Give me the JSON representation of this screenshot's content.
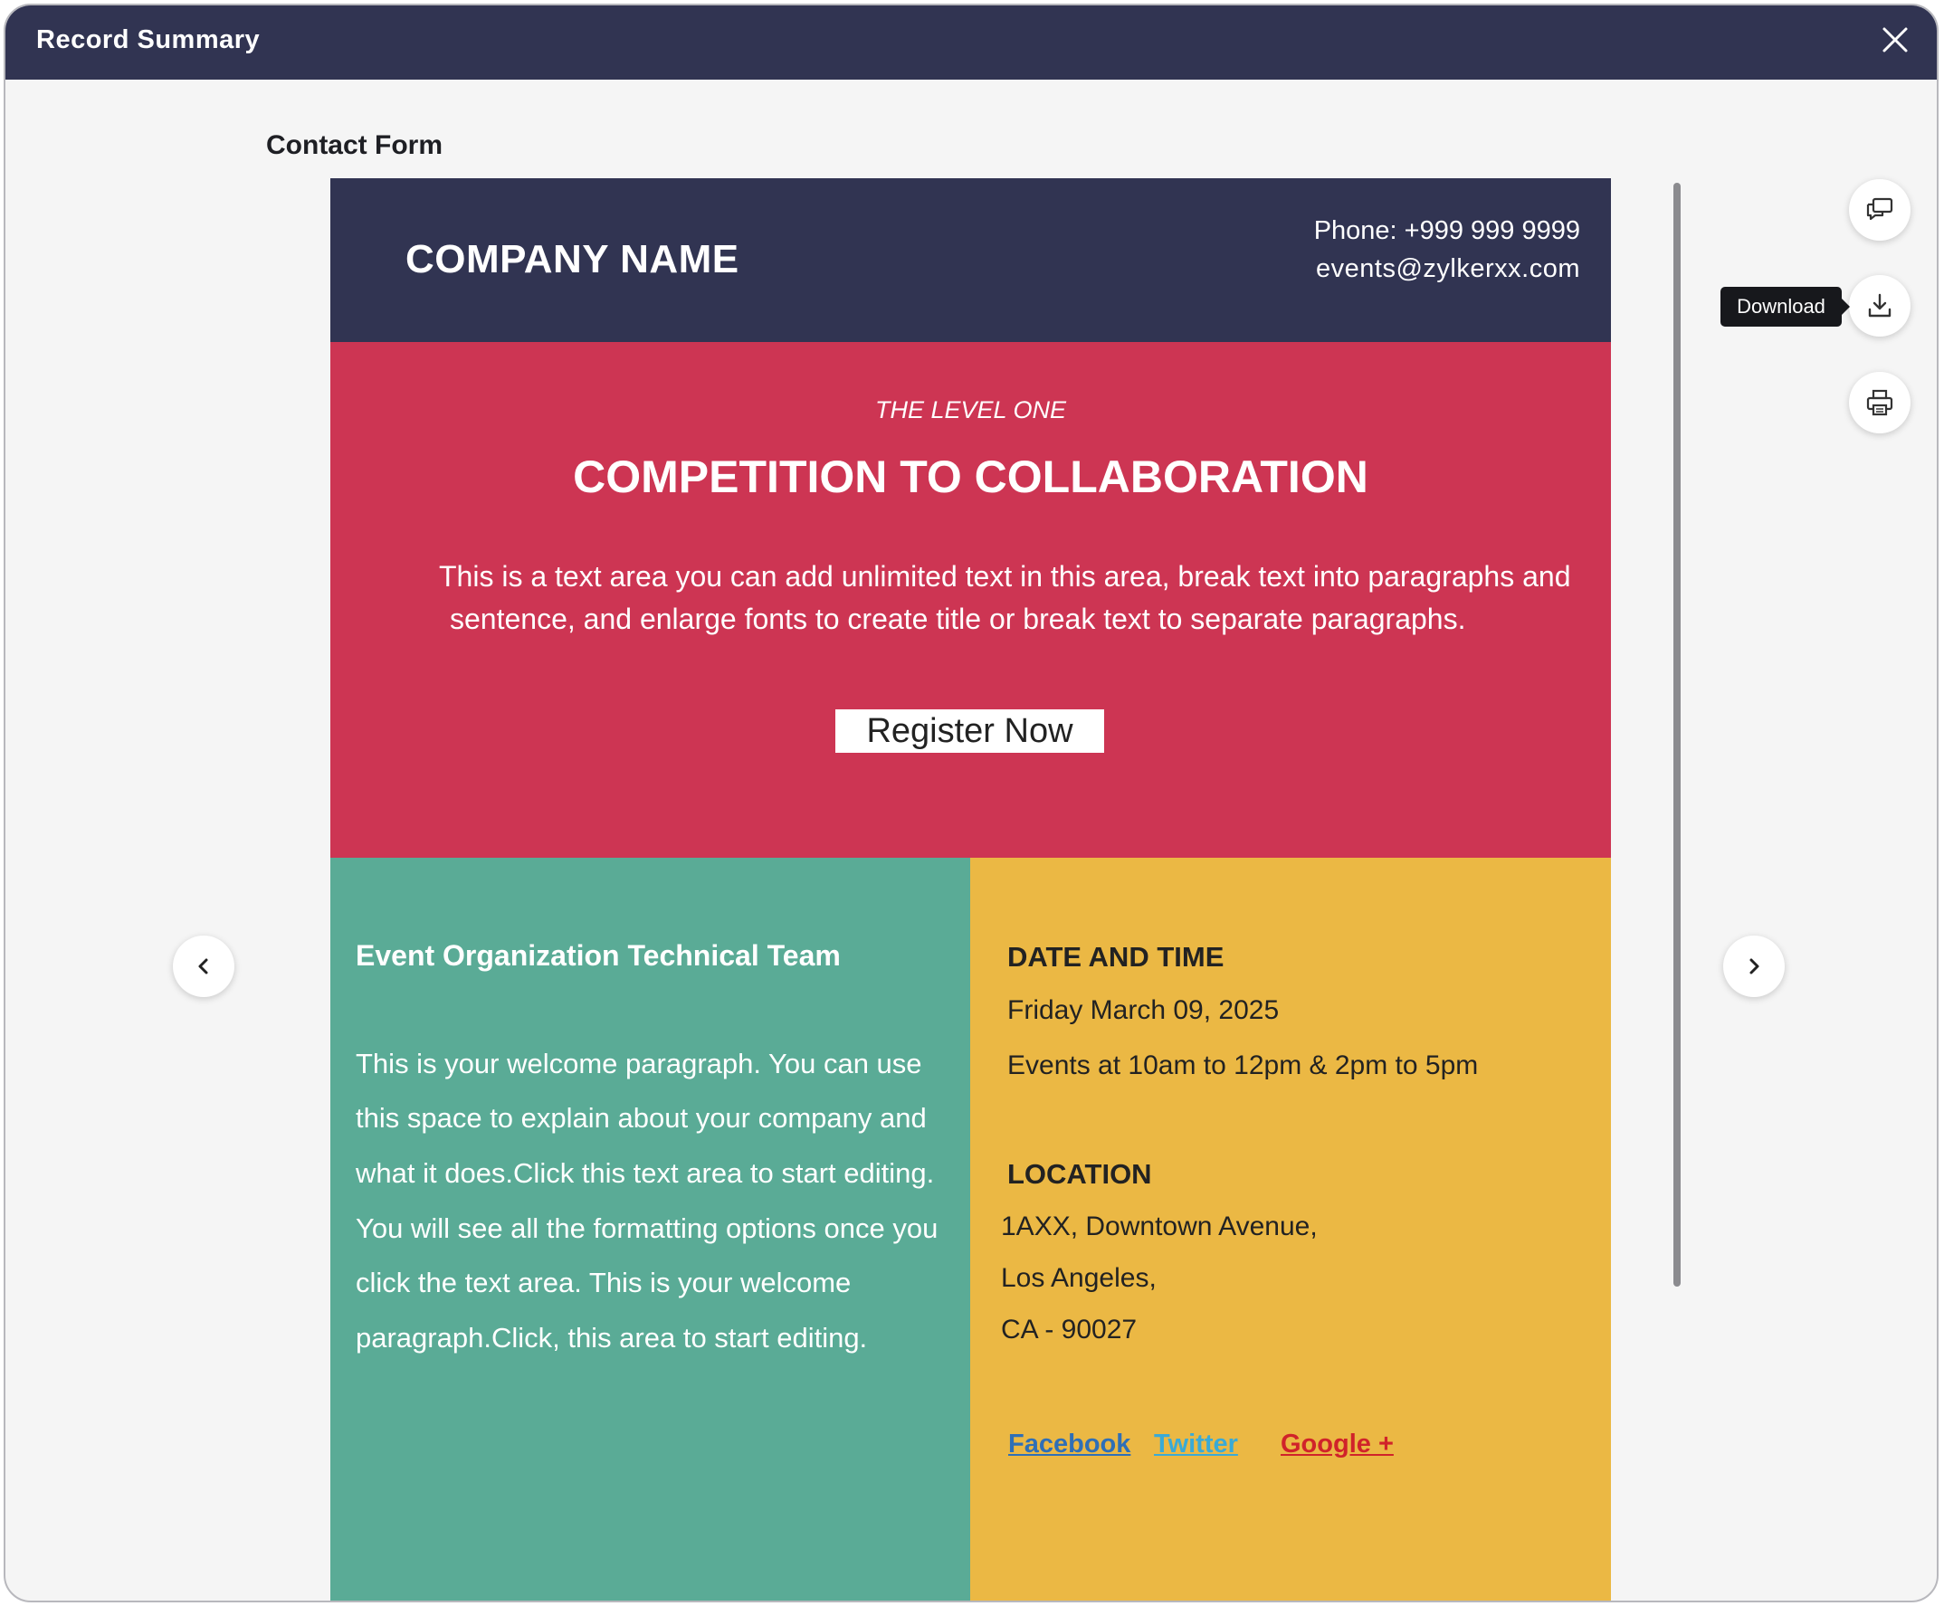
{
  "window": {
    "title": "Record Summary"
  },
  "form": {
    "label": "Contact Form"
  },
  "email": {
    "header": {
      "company": "COMPANY NAME",
      "phone": "Phone: +999 999 9999",
      "email": "events@zylkerxx.com"
    },
    "hero": {
      "subtitle": "THE LEVEL ONE",
      "title": "COMPETITION TO COLLABORATION",
      "body_lines": [
        "This is a text area you can add unlimited text in this area, break text into paragraphs and",
        "sentence, and enlarge fonts to create title or break text to separate  paragraphs."
      ],
      "button": "Register Now"
    },
    "left": {
      "title": "Event Organization Technical Team",
      "lines": [
        "This is your welcome paragraph. You can use",
        "this space to explain about your company  and",
        "what it does.Click this text area to start editing.",
        "You will see all the formatting options once you",
        "click the  text area. This is your welcome",
        "paragraph.Click, this area to start editing."
      ]
    },
    "right": {
      "datetime_heading": "DATE AND TIME",
      "date": "Friday  March 09, 2025",
      "times": "Events at 10am to 12pm & 2pm to 5pm",
      "location_heading": "LOCATION",
      "address_lines": [
        "1AXX, Downtown Avenue,",
        "Los Angeles,",
        "CA - 90027"
      ],
      "social": [
        {
          "label": "Facebook ",
          "color": "#2f6fb6"
        },
        {
          "label": "Twitter  ",
          "color": "#3aaad6"
        },
        {
          "label": "Google + ",
          "color": "#d0232a"
        }
      ]
    }
  },
  "side_actions": {
    "tooltip": "Download"
  },
  "colors": {
    "titlebar": "#313452",
    "hero": "#cd3553",
    "left_col": "#5aab96",
    "right_col": "#ebb844"
  }
}
